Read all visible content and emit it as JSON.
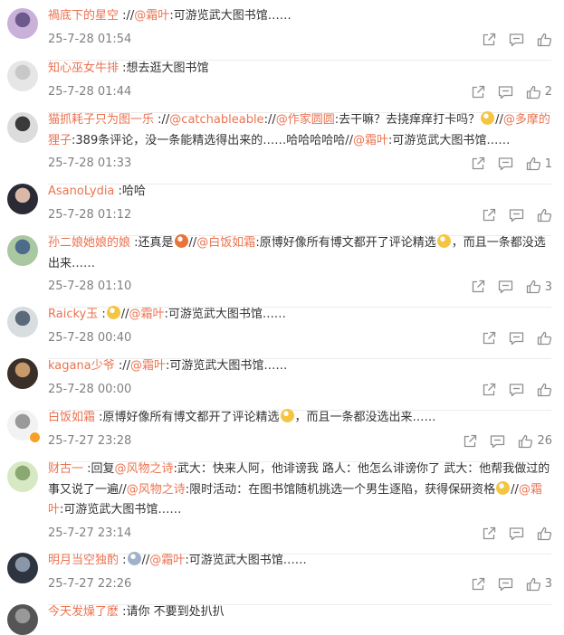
{
  "comments": [
    {
      "user": "禍底下的星空",
      "parts": [
        {
          "t": "text",
          "v": " ://"
        },
        {
          "t": "mention",
          "v": "@霜叶"
        },
        {
          "t": "text",
          "v": ":可游览武大图书馆……"
        }
      ],
      "time": "25-7-28 01:54",
      "likes": "",
      "avatar": [
        "#c9b1d9",
        "#6d5a8c"
      ]
    },
    {
      "user": "知心巫女牛排",
      "parts": [
        {
          "t": "text",
          "v": " :想去逛大图书馆"
        }
      ],
      "time": "25-7-28 01:44",
      "likes": "2",
      "avatar": [
        "#e6e6e6",
        "#c8c8c8"
      ]
    },
    {
      "user": "猫抓耗子只为图一乐",
      "parts": [
        {
          "t": "text",
          "v": " ://"
        },
        {
          "t": "mention",
          "v": "@catchableable"
        },
        {
          "t": "text",
          "v": "://"
        },
        {
          "t": "mention",
          "v": "@作家圆圆"
        },
        {
          "t": "text",
          "v": ":去干嘛？去挠痒痒打卡吗？"
        },
        {
          "t": "emoji",
          "v": "#f5c542"
        },
        {
          "t": "text",
          "v": "//"
        },
        {
          "t": "mention",
          "v": "@多摩的狸子"
        },
        {
          "t": "text",
          "v": ":389条评论，没一条能精选得出来的……哈哈哈哈哈//"
        },
        {
          "t": "mention",
          "v": "@霜叶"
        },
        {
          "t": "text",
          "v": ":可游览武大图书馆……"
        }
      ],
      "time": "25-7-28 01:33",
      "likes": "1",
      "avatar": [
        "#dcdcdc",
        "#3a3a3a"
      ]
    },
    {
      "user": "AsanoLydia",
      "parts": [
        {
          "t": "text",
          "v": " :哈哈"
        }
      ],
      "time": "25-7-28 01:12",
      "likes": "",
      "avatar": [
        "#2b2b35",
        "#d9b8a8"
      ]
    },
    {
      "user": "孙二娘她娘的娘",
      "parts": [
        {
          "t": "text",
          "v": " :还真是"
        },
        {
          "t": "emoji",
          "v": "#e8743b"
        },
        {
          "t": "text",
          "v": "//"
        },
        {
          "t": "mention",
          "v": "@白饭如霜"
        },
        {
          "t": "text",
          "v": ":原博好像所有博文都开了评论精选"
        },
        {
          "t": "emoji",
          "v": "#f5c542"
        },
        {
          "t": "text",
          "v": "，而且一条都没选出来……"
        }
      ],
      "time": "25-7-28 01:10",
      "likes": "3",
      "avatar": [
        "#a9c7a0",
        "#4d6b8a"
      ]
    },
    {
      "user": "Raicky玉",
      "parts": [
        {
          "t": "text",
          "v": " :"
        },
        {
          "t": "emoji",
          "v": "#f5c542"
        },
        {
          "t": "text",
          "v": "//"
        },
        {
          "t": "mention",
          "v": "@霜叶"
        },
        {
          "t": "text",
          "v": ":可游览武大图书馆……"
        }
      ],
      "time": "25-7-28 00:40",
      "likes": "",
      "avatar": [
        "#d8dde0",
        "#5a6a78"
      ]
    },
    {
      "user": "kagana少爷",
      "parts": [
        {
          "t": "text",
          "v": " ://"
        },
        {
          "t": "mention",
          "v": "@霜叶"
        },
        {
          "t": "text",
          "v": ":可游览武大图书馆……"
        }
      ],
      "time": "25-7-28 00:00",
      "likes": "",
      "avatar": [
        "#3b2f2a",
        "#c79a6b"
      ]
    },
    {
      "user": "白饭如霜",
      "parts": [
        {
          "t": "text",
          "v": " :原博好像所有博文都开了评论精选"
        },
        {
          "t": "emoji",
          "v": "#f5c542"
        },
        {
          "t": "text",
          "v": "，而且一条都没选出来……"
        }
      ],
      "time": "25-7-27 23:28",
      "likes": "26",
      "avatar": [
        "#f2f2f2",
        "#9a9a9a"
      ]
    },
    {
      "user": "财古一",
      "parts": [
        {
          "t": "text",
          "v": " :回复"
        },
        {
          "t": "mention",
          "v": "@风物之诗"
        },
        {
          "t": "text",
          "v": ":武大：快来人阿，他诽谤我 路人：他怎么诽谤你了 武大：他帮我做过的事又说了一遍//"
        },
        {
          "t": "mention",
          "v": "@风物之诗"
        },
        {
          "t": "text",
          "v": ":限时活动：在图书馆随机挑选一个男生逐陷，获得保研资格"
        },
        {
          "t": "emoji",
          "v": "#f5c542"
        },
        {
          "t": "text",
          "v": "//"
        },
        {
          "t": "mention",
          "v": "@霜叶"
        },
        {
          "t": "text",
          "v": ":可游览武大图书馆……"
        }
      ],
      "time": "25-7-27 23:14",
      "likes": "",
      "avatar": [
        "#d7e8c4",
        "#8aa870"
      ]
    },
    {
      "user": "明月当空独酌",
      "parts": [
        {
          "t": "text",
          "v": " :"
        },
        {
          "t": "emoji",
          "v": "#9fb3c8"
        },
        {
          "t": "text",
          "v": "//"
        },
        {
          "t": "mention",
          "v": "@霜叶"
        },
        {
          "t": "text",
          "v": ":可游览武大图书馆……"
        }
      ],
      "time": "25-7-27 22:26",
      "likes": "3",
      "avatar": [
        "#2e3540",
        "#8a97a8"
      ]
    },
    {
      "user": "今天发燥了麽",
      "parts": [
        {
          "t": "text",
          "v": " :请你 不要到处扒扒"
        }
      ],
      "time": "",
      "likes": "",
      "avatar": [
        "#555555",
        "#999999"
      ]
    }
  ]
}
